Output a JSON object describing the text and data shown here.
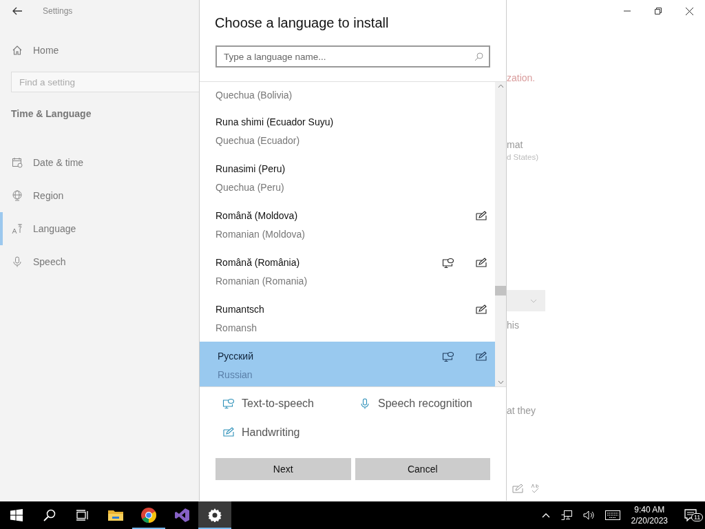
{
  "settings": {
    "title": "Settings",
    "home": "Home",
    "search": {
      "placeholder": "Find a setting"
    },
    "section": "Time & Language",
    "nav": [
      {
        "label": "Date & time",
        "kind": "calendar",
        "selected": false
      },
      {
        "label": "Region",
        "kind": "globe",
        "selected": false
      },
      {
        "label": "Language",
        "kind": "language",
        "selected": true
      },
      {
        "label": "Speech",
        "kind": "microphone",
        "selected": false
      }
    ]
  },
  "background_text": [
    {
      "text": "zation.",
      "kind": "warning"
    },
    {
      "text": "mat",
      "kind": "label"
    },
    {
      "text": "d States)",
      "kind": "caption"
    },
    {
      "text": "his",
      "kind": "label"
    },
    {
      "text": "at they",
      "kind": "label"
    }
  ],
  "dialog": {
    "title": "Choose a language to install",
    "search": {
      "placeholder": "Type a language name..."
    },
    "languages": [
      {
        "english": "Quechua (Bolivia)",
        "text_to_speech": false,
        "handwriting": false,
        "selected": false
      },
      {
        "native": "Runa shimi (Ecuador Suyu)",
        "english": "Quechua (Ecuador)",
        "text_to_speech": false,
        "handwriting": false,
        "selected": false
      },
      {
        "native": "Runasimi (Peru)",
        "english": "Quechua (Peru)",
        "text_to_speech": false,
        "handwriting": false,
        "selected": false
      },
      {
        "native": "Română (Moldova)",
        "english": "Romanian (Moldova)",
        "text_to_speech": false,
        "handwriting": true,
        "selected": false
      },
      {
        "native": "Română (România)",
        "english": "Romanian (Romania)",
        "text_to_speech": true,
        "handwriting": true,
        "selected": false
      },
      {
        "native": "Rumantsch",
        "english": "Romansh",
        "text_to_speech": false,
        "handwriting": true,
        "selected": false
      },
      {
        "native": "Русский",
        "english": "Russian",
        "text_to_speech": true,
        "handwriting": true,
        "selected": true
      }
    ],
    "legend": [
      {
        "kind": "tts",
        "label": "Text-to-speech"
      },
      {
        "kind": "speech",
        "label": "Speech recognition"
      },
      {
        "kind": "handwriting",
        "label": "Handwriting"
      }
    ],
    "buttons": [
      "Next",
      "Cancel"
    ]
  },
  "taskbar": {
    "apps": [
      {
        "kind": "explorer",
        "running": false,
        "selected": false
      },
      {
        "kind": "browser",
        "running": true,
        "selected": false
      },
      {
        "kind": "ide",
        "running": false,
        "selected": false
      },
      {
        "kind": "settings",
        "running": true,
        "selected": true
      }
    ],
    "time": "9:40 AM",
    "date": "2/20/2023",
    "notifications": "11"
  }
}
